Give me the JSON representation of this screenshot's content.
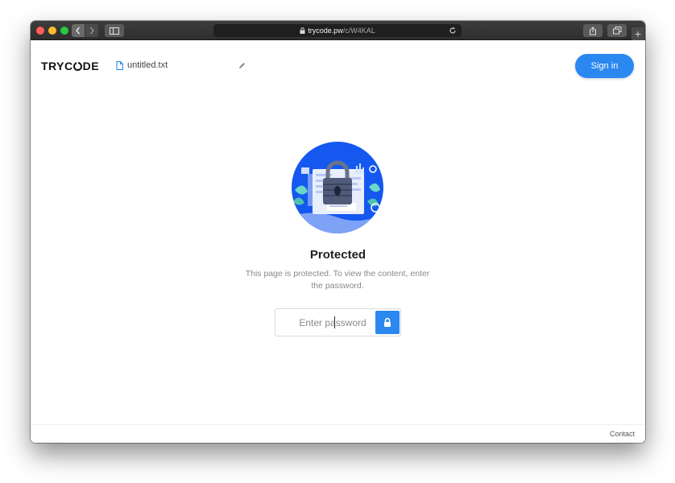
{
  "browser": {
    "url_host": "trycode.pw",
    "url_path": "/c/W4KAL",
    "new_tab_glyph": "+"
  },
  "header": {
    "brand_parts": [
      "TRYC",
      "DE"
    ],
    "filename": "untitled.txt",
    "signin_label": "Sign in"
  },
  "lock_screen": {
    "title": "Protected",
    "description": "This page is protected. To view the content, enter the password.",
    "password_placeholder": "Enter password"
  },
  "footer": {
    "contact_label": "Contact"
  },
  "colors": {
    "accent": "#2b88f0",
    "illustration_blue": "#1458f0"
  },
  "icons": [
    "lock-icon",
    "reload-icon",
    "file-icon",
    "pencil-icon",
    "share-icon",
    "tabs-icon",
    "sidebar-icon",
    "unlock-icon"
  ]
}
